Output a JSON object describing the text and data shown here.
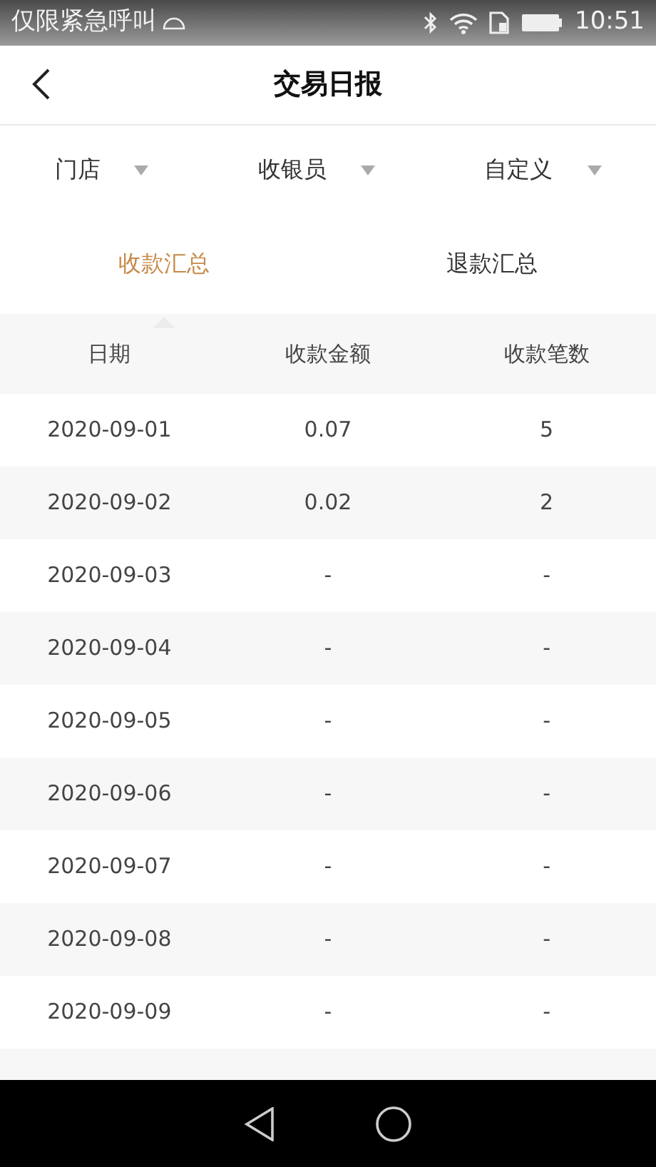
{
  "status_bar": {
    "carrier": "仅限紧急呼叫",
    "time": "10:51"
  },
  "header": {
    "title": "交易日报"
  },
  "filters": [
    {
      "label": "门店"
    },
    {
      "label": "收银员"
    },
    {
      "label": "自定义"
    }
  ],
  "tabs": [
    {
      "label": "收款汇总",
      "selected": true
    },
    {
      "label": "退款汇总",
      "selected": false
    }
  ],
  "table": {
    "columns": [
      "日期",
      "收款金额",
      "收款笔数"
    ],
    "rows": [
      [
        "2020-09-01",
        "0.07",
        "5"
      ],
      [
        "2020-09-02",
        "0.02",
        "2"
      ],
      [
        "2020-09-03",
        "-",
        "-"
      ],
      [
        "2020-09-04",
        "-",
        "-"
      ],
      [
        "2020-09-05",
        "-",
        "-"
      ],
      [
        "2020-09-06",
        "-",
        "-"
      ],
      [
        "2020-09-07",
        "-",
        "-"
      ],
      [
        "2020-09-08",
        "-",
        "-"
      ],
      [
        "2020-09-09",
        "-",
        "-"
      ]
    ]
  }
}
